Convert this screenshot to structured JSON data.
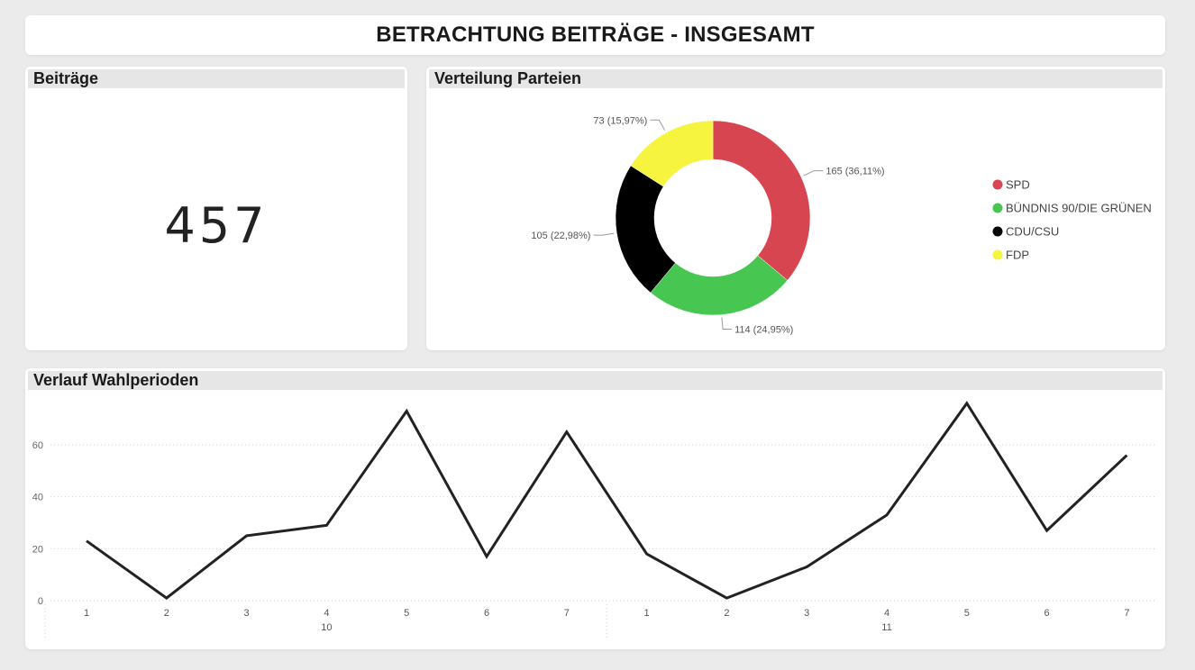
{
  "page": {
    "title": "BETRACHTUNG BEITRÄGE - INSGESAMT"
  },
  "kpi": {
    "header": "Beiträge",
    "value": "457"
  },
  "donut": {
    "header": "Verteilung Parteien",
    "legend": [
      {
        "label": "SPD",
        "color": "#d64550"
      },
      {
        "label": "BÜNDNIS 90/DIE GRÜNEN",
        "color": "#47c752"
      },
      {
        "label": "CDU/CSU",
        "color": "#000000"
      },
      {
        "label": "FDP",
        "color": "#f7f43f"
      }
    ]
  },
  "line": {
    "header": "Verlauf Wahlperioden"
  },
  "chart_data": [
    {
      "type": "pie",
      "variant": "donut",
      "categories": [
        "SPD",
        "BÜNDNIS 90/DIE GRÜNEN",
        "CDU/CSU",
        "FDP"
      ],
      "values": [
        165,
        114,
        105,
        73
      ],
      "data_labels": [
        "165 (36,11%)",
        "114 (24,95%)",
        "105 (22,98%)",
        "73 (15,97%)"
      ],
      "colors": [
        "#d64550",
        "#47c752",
        "#000000",
        "#f7f43f"
      ],
      "legend_position": "right"
    },
    {
      "type": "line",
      "x": [
        {
          "tick": "1",
          "group": "10"
        },
        {
          "tick": "2",
          "group": "10"
        },
        {
          "tick": "3",
          "group": "10"
        },
        {
          "tick": "4",
          "group": "10"
        },
        {
          "tick": "5",
          "group": "10"
        },
        {
          "tick": "6",
          "group": "10"
        },
        {
          "tick": "7",
          "group": "10"
        },
        {
          "tick": "1",
          "group": "11"
        },
        {
          "tick": "2",
          "group": "11"
        },
        {
          "tick": "3",
          "group": "11"
        },
        {
          "tick": "4",
          "group": "11"
        },
        {
          "tick": "5",
          "group": "11"
        },
        {
          "tick": "6",
          "group": "11"
        },
        {
          "tick": "7",
          "group": "11"
        }
      ],
      "groups": [
        "10",
        "11"
      ],
      "series": [
        {
          "values": [
            23,
            1,
            25,
            29,
            73,
            17,
            65,
            18,
            1,
            13,
            33,
            76,
            27,
            56
          ]
        }
      ],
      "yticks": [
        0,
        20,
        40,
        60
      ],
      "ylim": [
        0,
        78
      ],
      "grid": true,
      "color": "#222222"
    }
  ]
}
